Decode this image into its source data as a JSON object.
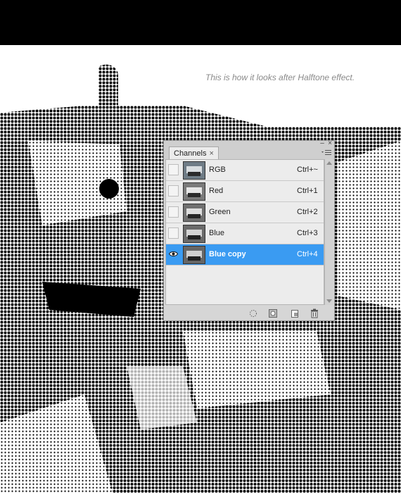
{
  "caption": "This is how it looks after Halftone effect.",
  "panel": {
    "tab_label": "Channels",
    "tab_close_glyph": "×",
    "minimize_glyph": "–",
    "close_glyph": "×",
    "menu_icon": "panel-menu-icon",
    "channels": [
      {
        "name": "RGB",
        "shortcut": "Ctrl+~",
        "visible": false,
        "selected": false
      },
      {
        "name": "Red",
        "shortcut": "Ctrl+1",
        "visible": false,
        "selected": false
      },
      {
        "name": "Green",
        "shortcut": "Ctrl+2",
        "visible": false,
        "selected": false
      },
      {
        "name": "Blue",
        "shortcut": "Ctrl+3",
        "visible": false,
        "selected": false
      },
      {
        "name": "Blue copy",
        "shortcut": "Ctrl+4",
        "visible": true,
        "selected": true
      }
    ],
    "footer_buttons": [
      "load-selection-icon",
      "save-selection-icon",
      "new-channel-icon",
      "trash-icon"
    ]
  },
  "colors": {
    "selection": "#3a9bf2",
    "top_bar": "#000000",
    "caption": "#8a8a8a"
  }
}
